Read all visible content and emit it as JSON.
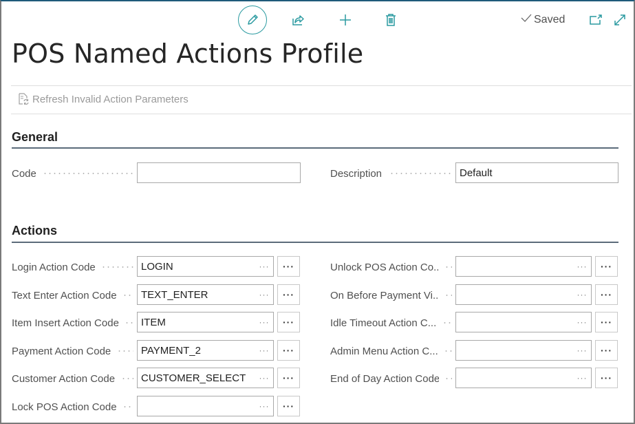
{
  "toolbar": {
    "edit_icon": "pencil-icon",
    "share_icon": "share-icon",
    "new_icon": "plus-icon",
    "delete_icon": "trash-icon",
    "saved_label": "Saved",
    "popout_icon": "open-in-new-window-icon",
    "expand_icon": "expand-icon",
    "accent_color": "#2a9aa0"
  },
  "page": {
    "title": "POS Named Actions Profile"
  },
  "actions_bar": {
    "refresh_label": "Refresh Invalid Action Parameters"
  },
  "general": {
    "title": "General",
    "code": {
      "label": "Code",
      "value": ""
    },
    "description": {
      "label": "Description",
      "value": "Default"
    }
  },
  "actions": {
    "title": "Actions",
    "lookup_glyph": "···",
    "assist_glyph": "···",
    "left": [
      {
        "label": "Login Action Code",
        "value": "LOGIN"
      },
      {
        "label": "Text Enter Action Code",
        "value": "TEXT_ENTER"
      },
      {
        "label": "Item Insert Action Code",
        "value": "ITEM"
      },
      {
        "label": "Payment Action Code",
        "value": "PAYMENT_2"
      },
      {
        "label": "Customer Action Code",
        "value": "CUSTOMER_SELECT"
      },
      {
        "label": "Lock POS Action Code",
        "value": ""
      }
    ],
    "right": [
      {
        "label": "Unlock POS Action Co...",
        "value": ""
      },
      {
        "label": "On Before Payment Vi...",
        "value": ""
      },
      {
        "label": "Idle Timeout Action C...",
        "value": ""
      },
      {
        "label": "Admin Menu Action C...",
        "value": ""
      },
      {
        "label": "End of Day Action Code",
        "value": ""
      }
    ]
  }
}
